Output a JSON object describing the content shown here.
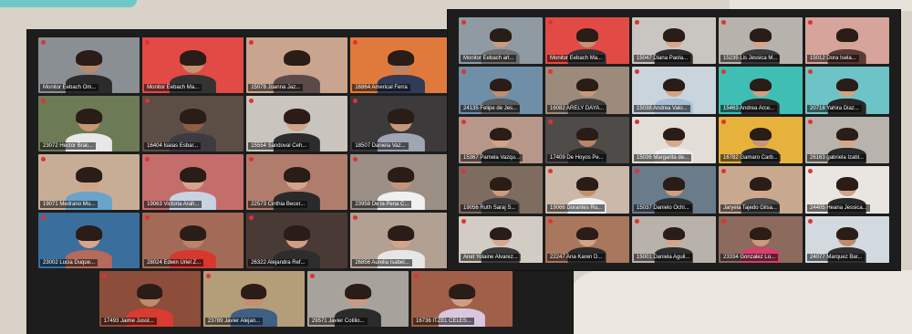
{
  "window1": {
    "tiles": [
      {
        "name": "Monitor Eebach Om...",
        "bg": "#8a8f94",
        "skin": "#b98a6a",
        "shirt": "#2b2b2b",
        "active": false
      },
      {
        "name": "Monitor Eebach Ma...",
        "bg": "#e24a46",
        "skin": "#c79272",
        "shirt": "#333333",
        "active": true
      },
      {
        "name": "15078 Joanna Jaz...",
        "bg": "#c9a48e",
        "skin": "#d4a58a",
        "shirt": "#5b4a48",
        "active": false
      },
      {
        "name": "16864 Americal Ferra",
        "bg": "#e07a3c",
        "skin": "#b98466",
        "shirt": "#2f3b57",
        "active": false
      },
      {
        "name": "23072 Hector Brac...",
        "bg": "#6d7a56",
        "skin": "#c9976f",
        "shirt": "#e8e8e8",
        "active": false
      },
      {
        "name": "16404 Isaias Esbar...",
        "bg": "#5d4e45",
        "skin": "#8f5e45",
        "shirt": "#3e3a42",
        "active": false
      },
      {
        "name": "15554 Sandoval Ceh...",
        "bg": "#c9c4bd",
        "skin": "#d0a488",
        "shirt": "#2c2c2c",
        "active": false
      },
      {
        "name": "18507 Daniela Vaz...",
        "bg": "#3c3a3a",
        "skin": "#c7977a",
        "shirt": "#9fa5b3",
        "active": false
      },
      {
        "name": "19071 Medrano Mu...",
        "bg": "#c8ad96",
        "skin": "#d1a487",
        "shirt": "#6aa3c9",
        "active": false
      },
      {
        "name": "19063 Victoria Arah...",
        "bg": "#c46e6b",
        "skin": "#d5a58e",
        "shirt": "#c9d2e3",
        "active": false
      },
      {
        "name": "22573 Cinthia Becer...",
        "bg": "#b07d6d",
        "skin": "#d4a58b",
        "shirt": "#2a2a2a",
        "active": false
      },
      {
        "name": "23958 De la Pena C...",
        "bg": "#9b8f86",
        "skin": "#c79479",
        "shirt": "#f0f0f0",
        "active": false
      },
      {
        "name": "23002 Lucia Duque...",
        "bg": "#3a6e9c",
        "skin": "#d6a68d",
        "shirt": "#b56a5b",
        "active": false
      },
      {
        "name": "28024 Edwin Uriel Z...",
        "bg": "#a36b57",
        "skin": "#b9866b",
        "shirt": "#d6382f",
        "active": false
      },
      {
        "name": "26322 Alejandra Ref...",
        "bg": "#4a3a36",
        "skin": "#cf9f86",
        "shirt": "#2d2d2d",
        "active": false
      },
      {
        "name": "26856 Aurelia Isabel...",
        "bg": "#b2a092",
        "skin": "#d3a489",
        "shirt": "#e6e6e6",
        "active": false
      },
      {
        "name": "17493 Jaime Jusst...",
        "bg": "#8c4d3a",
        "skin": "#bf8b6c",
        "shirt": "#d83c30",
        "active": false
      },
      {
        "name": "23789 Javier Alejan...",
        "bg": "#b49d79",
        "skin": "#c48f6c",
        "shirt": "#3f5f83",
        "active": false
      },
      {
        "name": "29571 Javier Cotilio...",
        "bg": "#a8a29c",
        "skin": "#c99a82",
        "shirt": "#2b2b2b",
        "active": false
      },
      {
        "name": "16736 ITZEL CELES...",
        "bg": "#9f5f48",
        "skin": "#cf9d83",
        "shirt": "#d9c7e0",
        "active": false
      }
    ]
  },
  "window2": {
    "tiles": [
      {
        "name": "Monitor Eebach arl...",
        "bg": "#8f9aa3",
        "skin": "#cc9b80",
        "shirt": "#6d6d6d",
        "active": false
      },
      {
        "name": "Monitor Eebach Ma...",
        "bg": "#e24a46",
        "skin": "#c79272",
        "shirt": "#333333",
        "active": true
      },
      {
        "name": "15047 Diana Paola...",
        "bg": "#c9c6c2",
        "skin": "#d5a78b",
        "shirt": "#2c2c2c",
        "active": false
      },
      {
        "name": "15235 Lis Jessica M...",
        "bg": "#b7b2ab",
        "skin": "#d4a68b",
        "shirt": "#3a3a3a",
        "active": false
      },
      {
        "name": "15012 Dora Isela...",
        "bg": "#d6a49a",
        "skin": "#d4a68b",
        "shirt": "#5a3a34",
        "active": false
      },
      {
        "name": "24135 Felipe de Jes...",
        "bg": "#6f8fa8",
        "skin": "#c18e6d",
        "shirt": "#5a5a5a",
        "active": false
      },
      {
        "name": "16082 ARELY DAYA...",
        "bg": "#9c8a7a",
        "skin": "#c9977a",
        "shirt": "#3b3b3b",
        "active": false
      },
      {
        "name": "15038 Andrea Valo...",
        "bg": "#c9d4dd",
        "skin": "#d2a388",
        "shirt": "#a7bfd4",
        "active": false
      },
      {
        "name": "15463 Andrea Arce...",
        "bg": "#3fbfb4",
        "skin": "#cfa084",
        "shirt": "#2b2b2b",
        "active": false
      },
      {
        "name": "20718 Yahira Diaz...",
        "bg": "#6ec3c6",
        "skin": "#d0a286",
        "shirt": "#282828",
        "active": false
      },
      {
        "name": "15367 Pamela Vazqu...",
        "bg": "#b6978a",
        "skin": "#d3a387",
        "shirt": "#303030",
        "active": false
      },
      {
        "name": "17409 De Hoyos Pe...",
        "bg": "#4f4b49",
        "skin": "#b98669",
        "shirt": "#2a2a2a",
        "active": false
      },
      {
        "name": "15036 Margarita de...",
        "bg": "#e2ddd6",
        "skin": "#d6a88d",
        "shirt": "#ededed",
        "active": false
      },
      {
        "name": "16782 Gamaro Carb...",
        "bg": "#e7b23c",
        "skin": "#c69577",
        "shirt": "#2b2b2b",
        "active": false
      },
      {
        "name": "26163 gabriela Izabl...",
        "bg": "#b9b3ad",
        "skin": "#d3a589",
        "shirt": "#2a2a2a",
        "active": false
      },
      {
        "name": "19056 Ruth Saraj S...",
        "bg": "#7f6c60",
        "skin": "#cd9c7f",
        "shirt": "#3a3a3a",
        "active": false
      },
      {
        "name": "19066 Dorantes Ru...",
        "bg": "#cab9a9",
        "skin": "#c6906e",
        "shirt": "#f2f2f2",
        "active": false
      },
      {
        "name": "15037 Danielo Ochi...",
        "bg": "#6a7b8a",
        "skin": "#cf9f84",
        "shirt": "#2c2c2c",
        "active": false
      },
      {
        "name": "Jaryela Tajedo Gilsa...",
        "bg": "#c8a98f",
        "skin": "#d5a68b",
        "shirt": "#4a4a4a",
        "active": false
      },
      {
        "name": "24405 Heana Jessica...",
        "bg": "#e9e6e2",
        "skin": "#d2a387",
        "shirt": "#2a2a2a",
        "active": false
      },
      {
        "name": "Anet Yolaine Alvarez...",
        "bg": "#d2ccc4",
        "skin": "#d6a98f",
        "shirt": "#3a3a3a",
        "active": false
      },
      {
        "name": "22247 Ana Karen D...",
        "bg": "#a9765e",
        "skin": "#d2a387",
        "shirt": "#2b2b2b",
        "active": false
      },
      {
        "name": "15001 Daniela Aguil...",
        "bg": "#b9b2aa",
        "skin": "#d4a78c",
        "shirt": "#2e2e2e",
        "active": false
      },
      {
        "name": "23334 Gonzalez Lo...",
        "bg": "#8c6a5e",
        "skin": "#cc9a7d",
        "shirt": "#d6406a",
        "active": false
      },
      {
        "name": "24077 Marquez Bar...",
        "bg": "#d2d9df",
        "skin": "#c08c6c",
        "shirt": "#2f2f2f",
        "active": false
      }
    ]
  }
}
